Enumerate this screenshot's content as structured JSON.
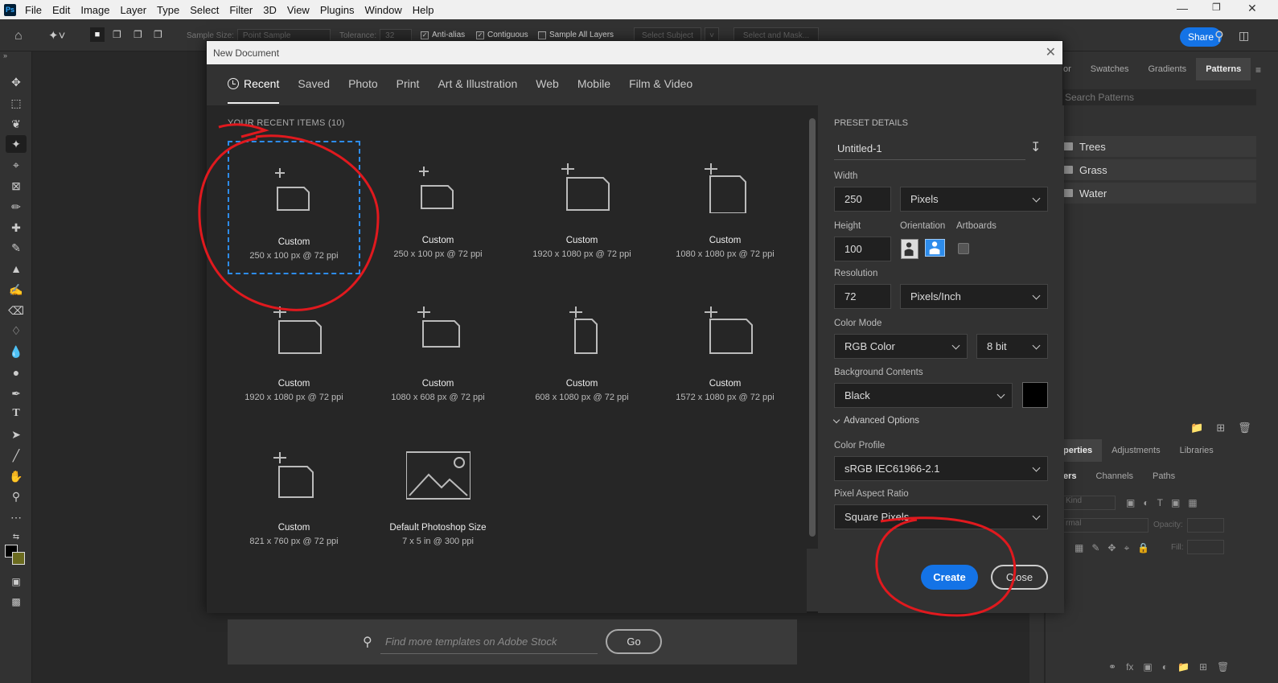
{
  "menubar": {
    "logo": "Ps",
    "items": [
      "File",
      "Edit",
      "Image",
      "Layer",
      "Type",
      "Select",
      "Filter",
      "3D",
      "View",
      "Plugins",
      "Window",
      "Help"
    ]
  },
  "options": {
    "sample_size_label": "Sample Size:",
    "sample_size_value": "Point Sample",
    "tolerance_label": "Tolerance:",
    "tolerance_value": "32",
    "anti_alias": "Anti-alias",
    "contiguous": "Contiguous",
    "sample_all_layers": "Sample All Layers",
    "select_subject": "Select Subject",
    "select_and_mask": "Select and Mask...",
    "share": "Share"
  },
  "right_panel": {
    "tabs_top": [
      "or",
      "Swatches",
      "Gradients",
      "Patterns"
    ],
    "search_placeholder": "Search Patterns",
    "folders": [
      "Trees",
      "Grass",
      "Water"
    ],
    "tabs_mid": [
      "perties",
      "Adjustments",
      "Libraries"
    ],
    "tabs_low": [
      "ers",
      "Channels",
      "Paths"
    ],
    "kind_label": "Kind",
    "blend_label": "rmal",
    "opacity_label": "Opacity:",
    "fill_label": "Fill:"
  },
  "dialog": {
    "title": "New Document",
    "categories": [
      "Recent",
      "Saved",
      "Photo",
      "Print",
      "Art & Illustration",
      "Web",
      "Mobile",
      "Film & Video"
    ],
    "recent_heading": "YOUR RECENT ITEMS",
    "recent_count": "(10)",
    "items": [
      {
        "name": "Custom",
        "dim": "250 x 100 px @ 72 ppi"
      },
      {
        "name": "Custom",
        "dim": "250 x 100 px @ 72 ppi"
      },
      {
        "name": "Custom",
        "dim": "1920 x 1080 px @ 72 ppi"
      },
      {
        "name": "Custom",
        "dim": "1080 x 1080 px @ 72 ppi"
      },
      {
        "name": "Custom",
        "dim": "1920 x 1080 px @ 72 ppi"
      },
      {
        "name": "Custom",
        "dim": "1080 x 608 px @ 72 ppi"
      },
      {
        "name": "Custom",
        "dim": "608 x 1080 px @ 72 ppi"
      },
      {
        "name": "Custom",
        "dim": "1572 x 1080 px @ 72 ppi"
      },
      {
        "name": "Custom",
        "dim": "821 x 760 px @ 72 ppi"
      },
      {
        "name": "Default Photoshop Size",
        "dim": "7 x 5 in @ 300 ppi"
      }
    ],
    "search_placeholder": "Find more templates on Adobe Stock",
    "go": "Go",
    "preset": {
      "heading": "PRESET DETAILS",
      "name": "Untitled-1",
      "width_label": "Width",
      "width": "250",
      "width_unit": "Pixels",
      "height_label": "Height",
      "height": "100",
      "orientation_label": "Orientation",
      "artboards_label": "Artboards",
      "resolution_label": "Resolution",
      "resolution": "72",
      "resolution_unit": "Pixels/Inch",
      "color_mode_label": "Color Mode",
      "color_mode": "RGB Color",
      "bit_depth": "8 bit",
      "background_label": "Background Contents",
      "background": "Black",
      "advanced": "Advanced Options",
      "profile_label": "Color Profile",
      "profile": "sRGB IEC61966-2.1",
      "pixel_aspect_label": "Pixel Aspect Ratio",
      "pixel_aspect": "Square Pixels"
    },
    "create": "Create",
    "close": "Close"
  },
  "colors": {
    "accent": "#1473e6",
    "annotation": "#e0191e",
    "background_swatch": "#000000"
  }
}
